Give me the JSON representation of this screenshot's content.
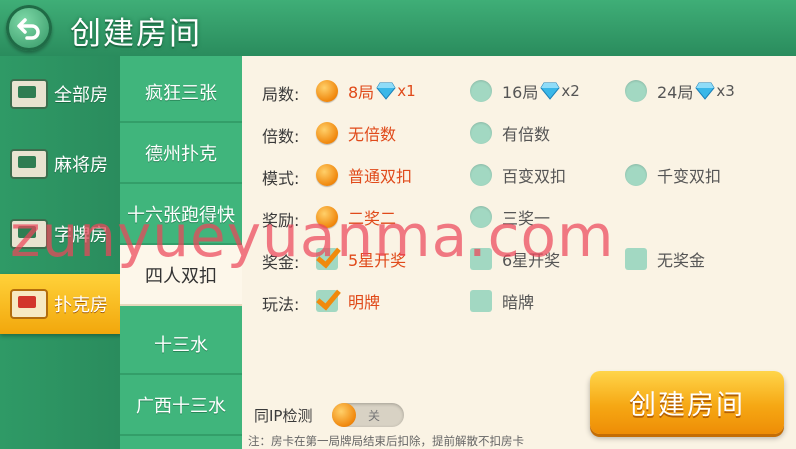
{
  "header": {
    "title": "创建房间"
  },
  "categories": [
    {
      "label": "全部房",
      "icon": "mahjong-tile-icon",
      "active": false
    },
    {
      "label": "麻将房",
      "icon": "mahjong-tile-icon",
      "active": false
    },
    {
      "label": "字牌房",
      "icon": "card-fan-icon",
      "active": false
    },
    {
      "label": "扑克房",
      "icon": "poker-card-icon",
      "active": true
    }
  ],
  "games": [
    {
      "label": "疯狂三张",
      "active": false
    },
    {
      "label": "德州扑克",
      "active": false
    },
    {
      "label": "十六张跑得快",
      "active": false
    },
    {
      "label": "四人双扣",
      "active": true
    },
    {
      "label": "十三水",
      "active": false
    },
    {
      "label": "广西十三水",
      "active": false
    }
  ],
  "options": {
    "rounds": {
      "label": "局数:",
      "items": [
        {
          "text": "8局",
          "mult": "x1",
          "selected": true
        },
        {
          "text": "16局",
          "mult": "x2",
          "selected": false
        },
        {
          "text": "24局",
          "mult": "x3",
          "selected": false
        }
      ]
    },
    "multiplier": {
      "label": "倍数:",
      "items": [
        {
          "text": "无倍数",
          "selected": true
        },
        {
          "text": "有倍数",
          "selected": false
        }
      ]
    },
    "mode": {
      "label": "模式:",
      "items": [
        {
          "text": "普通双扣",
          "selected": true
        },
        {
          "text": "百变双扣",
          "selected": false
        },
        {
          "text": "千变双扣",
          "selected": false
        }
      ]
    },
    "reward": {
      "label": "奖励:",
      "items": [
        {
          "text": "二奖二",
          "selected": true
        },
        {
          "text": "三奖一",
          "selected": false
        }
      ]
    },
    "bonus": {
      "label": "奖金:",
      "items": [
        {
          "text": "5星开奖",
          "selected": true
        },
        {
          "text": "6星开奖",
          "selected": false
        },
        {
          "text": "无奖金",
          "selected": false
        }
      ]
    },
    "play": {
      "label": "玩法:",
      "items": [
        {
          "text": "明牌",
          "selected": true
        },
        {
          "text": "暗牌",
          "selected": false
        }
      ]
    }
  },
  "ip_check": {
    "label": "同IP检测",
    "state": "关"
  },
  "note": "注：房卡在第一局牌局结束后扣除，提前解散不扣房卡",
  "create_button": "创建房间",
  "watermark": "zunyueyuanma.com",
  "colors": {
    "accent": "#f6a814",
    "selected_text": "#e04a1a",
    "primary_green": "#2a8c5d"
  }
}
